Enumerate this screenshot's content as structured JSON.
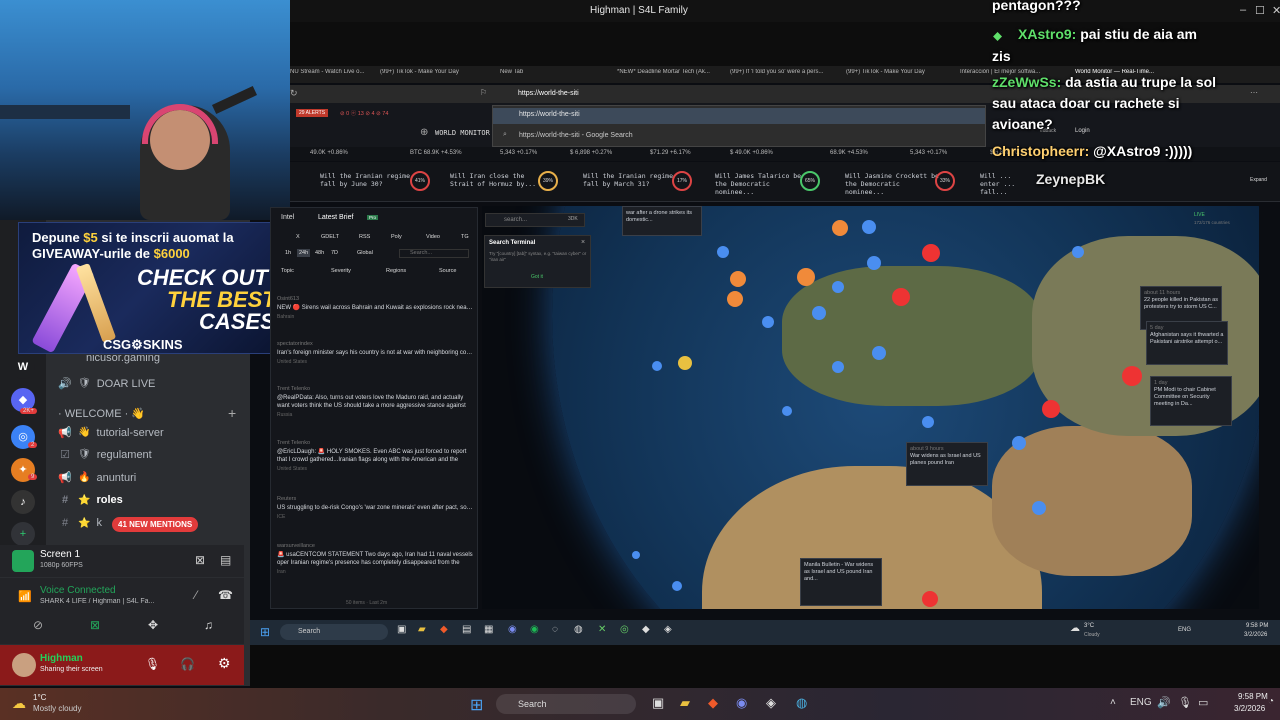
{
  "stream_window": {
    "title": "Highman | S4L Family",
    "controls": [
      "–",
      "☐",
      "✕"
    ]
  },
  "ad": {
    "line1_pre": "Depune ",
    "line1_amount": "$5",
    "line1_post": " si te inscrii auomat la",
    "line2_pre": "GIVEAWAY-urile de ",
    "line2_amount": "$6000",
    "headline1": "CHECK OUT",
    "headline2": "THE BEST",
    "headline3": "CASES",
    "brand": "CSG⚙SKINS"
  },
  "discord": {
    "channels": [
      {
        "icon": "🔊",
        "emoji": "",
        "label": "nicusor.gaming"
      },
      {
        "icon": "🔊",
        "emoji": "🛡",
        "label": "DOAR LIVE"
      },
      {
        "icon": "",
        "emoji": "",
        "label": "· WELCOME · 👋"
      },
      {
        "icon": "📢",
        "emoji": "👋",
        "label": "tutorial-server"
      },
      {
        "icon": "☑",
        "emoji": "🛡",
        "label": "regulament"
      },
      {
        "icon": "📢",
        "emoji": "🔥",
        "label": "anunturi"
      },
      {
        "icon": "#",
        "emoji": "⭐",
        "label": "roles"
      },
      {
        "icon": "#",
        "emoji": "⭐",
        "label": "k"
      }
    ],
    "new_mentions": "41 NEW MENTIONS",
    "server_badges": [
      "2K+",
      "2",
      "9"
    ],
    "screen": {
      "title": "Screen 1",
      "sub": "1080p 60FPS"
    },
    "voice": {
      "status": "Voice Connected",
      "channel": "SHARK 4 LIFE / Highman | S4L Fa..."
    },
    "user": {
      "name": "Highman",
      "status": "Sharing their screen"
    }
  },
  "browser": {
    "tabs": [
      "NU Stream - Watch Live o...",
      "(99+) TikTok - Make Your Day",
      "New Tab",
      "*NEW* Deadline Mortar Tech (Ak...",
      "(99+) If 'I told you so' were a pers...",
      "(99+) TikTok - Make Your Day",
      "Interacción | El mejor softwa...",
      "World Monitor — Real-Time..."
    ],
    "url": "https://world-the-siti",
    "suggestions": [
      "https://world-the-siti",
      "https://world-the-siti - Google Search"
    ]
  },
  "worldmonitor": {
    "alerts": "29 ALERTS",
    "counts": "⊘ 0 ⓔ 13 ⊘ 4 ⊘ 74",
    "brand": "WORLD MONITOR",
    "feedback": "edback",
    "login": "Login",
    "ticker": [
      "49.0K +0.86%",
      "BTC 68.9K +4.53%",
      "5,343 +0.17%",
      "$ 6,898 +0.27%",
      "$71.29 +6.17%",
      "$ 49.0K +0.86%",
      "68.9K +4.53%",
      "5,343 +0.17%",
      "$ 6,898 +0.2"
    ],
    "predictions": [
      {
        "q": "Will the Iranian regime fall by June 30?",
        "p": "41%"
      },
      {
        "q": "Will Iran close the Strait of Hormuz by...",
        "p": "39%"
      },
      {
        "q": "Will the Iranian regime fall by March 31?",
        "p": "17%"
      },
      {
        "q": "Will James Talarico be the Democratic nominee...",
        "p": "65%"
      },
      {
        "q": "Will Jasmine Crockett be the Democratic nominee...",
        "p": "33%"
      },
      {
        "q": "Will ... enter ... fall...",
        "p": ""
      }
    ],
    "expand": "Expand",
    "intel_tabs": [
      "Intel",
      "Latest Brief",
      "Pro"
    ],
    "filters": [
      "X",
      "GDELT",
      "RSS",
      "Poly",
      "Video",
      "TG"
    ],
    "time_filters": [
      "1h",
      "24h",
      "48h",
      "7D",
      "Global"
    ],
    "search_placeholder": "Search...",
    "dropdowns": [
      "Topic",
      "Severity",
      "Regions",
      "Source"
    ],
    "feed": [
      {
        "src": "Osint613",
        "tx": "NEW 🔴 Sirens wail across Bahrain and Kuwait as explosions rock near U.S",
        "loc": "Bahrain"
      },
      {
        "src": "spectatorindex",
        "tx": "Iran's foreign minister says his country is not at war with neighboring count",
        "loc": "United States"
      },
      {
        "src": "Trent Telenko",
        "tx": "@RealPData: Also, turns out voters love the Maduro raid, and actually want voters think the US should take a more aggressive stance against dictators",
        "loc": "Russia"
      },
      {
        "src": "Trent Telenko",
        "tx": "@EricLDaugh: 🚨 HOLY SMOKES. Even ABC was just forced to report that I crowd gathered...Iranian flags along with the American and the Israel flags.",
        "loc": "United States"
      },
      {
        "src": "Reuters",
        "tx": "US struggling to de-risk Congo's 'war zone minerals' even after pact, sourc",
        "loc": "ICE"
      },
      {
        "src": "warsurveillance",
        "tx": "🚨 usaCENTCOM STATEMENT Two days ago, Iran had 11 naval vessels oper Iranian regime's presence has completely disappeared from the area. For d",
        "loc": "Iran"
      }
    ],
    "footer": "50 items · Last 2m",
    "map_search": "search...",
    "map_search_btn": "3DK",
    "search_terminal": {
      "title": "Search Terminal",
      "hint": "Try \"[country] [tab]\" syntax, e.g. \"taiwan cyber\" or \"iran air\"",
      "btn": "Got it"
    },
    "live": "LIVE",
    "live_sub": "172/176 countries",
    "popups": [
      {
        "title": "war after a drone strikes its domestic...",
        "meta": ""
      },
      {
        "title": "22 people killed in Pakistan as protesters try to storm US C...",
        "meta": "about 11 hours"
      },
      {
        "title": "Afghanistan says it thwarted a Pakistani airstrike attempt o...",
        "meta": "5 day"
      },
      {
        "title": "PM Modi to chair Cabinet Committee on Security meeting in Da...",
        "meta": "1 day"
      },
      {
        "title": "War widens as Israel and US planes pound Iran",
        "meta": "about 9 hours"
      },
      {
        "title": "Manila Bulletin - War widens as Israel and US pound Iran and...",
        "meta": ""
      }
    ]
  },
  "chat": [
    {
      "name": "",
      "text": "pentagon???"
    },
    {
      "name": "XAstro9:",
      "text": " pai stiu de aia am"
    },
    {
      "name": "",
      "text": "zis"
    },
    {
      "name": "zZeWwSs:",
      "text": " da astia au trupe la sol"
    },
    {
      "name": "",
      "text": "sau ataca doar cu rachete si"
    },
    {
      "name": "",
      "text": "avioane?"
    },
    {
      "name": "Christopheerr:",
      "text": " @XAstro9 :)))))"
    },
    {
      "name": "ZeynepBK",
      "text": ""
    }
  ],
  "inner_taskbar": {
    "search": "Search",
    "weather_temp": "3°C",
    "weather": "Cloudy",
    "lang": "ENG",
    "time": "9:58 PM",
    "date": "3/2/2026"
  },
  "outer_taskbar": {
    "weather_temp": "1°C",
    "weather": "Mostly cloudy",
    "search": "Search",
    "lang": "ENG",
    "time": "9:58 PM",
    "date": "3/2/2026"
  }
}
